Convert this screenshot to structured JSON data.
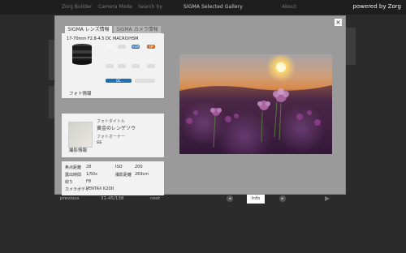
{
  "topbar": {
    "links": [
      "Zorg Builder",
      "Camera Mode",
      "Search by",
      "About"
    ],
    "title": "SIGMA Selected Gallery",
    "powered_by": "powered by Zorg"
  },
  "lightbox": {
    "close_label": "×",
    "tabs": [
      "SIGMA レンズ情報",
      "SIGMA カメラ情報"
    ],
    "lens": {
      "name": "17-70mm F2.8-4.5 DC MACRO/HSM",
      "badges": [
        {
          "label": "ASP",
          "color": "#555555"
        },
        {
          "label": "",
          "color": "#dddddd"
        },
        {
          "label": "HSM",
          "color": "#1e6fb8"
        },
        {
          "label": "1P",
          "color": "#e06a1c"
        }
      ],
      "badge2": [
        {
          "label": "DC",
          "color": "#1e6fb8"
        },
        {
          "label": "",
          "color": "#dddddd"
        }
      ]
    },
    "photo_info": {
      "tab_label": "フォト情報",
      "title_label": "フォトタイトル",
      "title_value": "黄金のレンゲソウ",
      "owner_label": "フォトオーナー",
      "owner_value": "ss"
    },
    "exif": {
      "tab_label": "撮影情報",
      "rows": [
        {
          "k1": "焦点距離",
          "v1": "28",
          "k2": "ISO",
          "v2": "200"
        },
        {
          "k1": "露出時間",
          "v1": "1/50s",
          "k2": "撮影距離",
          "v2": "269cm"
        },
        {
          "k1": "絞り",
          "v1": "F8",
          "k2": "",
          "v2": ""
        },
        {
          "k1": "カメラボディ",
          "v1": "PENTAX K20D",
          "k2": "",
          "v2": ""
        }
      ]
    }
  },
  "controls": {
    "previous": "previous",
    "counter": "31-45/138",
    "next": "next",
    "info": "Info",
    "left_arrow": "◂",
    "right_arrow": "▸"
  },
  "footer": {
    "play_symbol": "▶"
  },
  "colors": {
    "background": "#2b2b2b",
    "lightbox": "#9a9a9a",
    "panel": "#f2f2f2"
  }
}
